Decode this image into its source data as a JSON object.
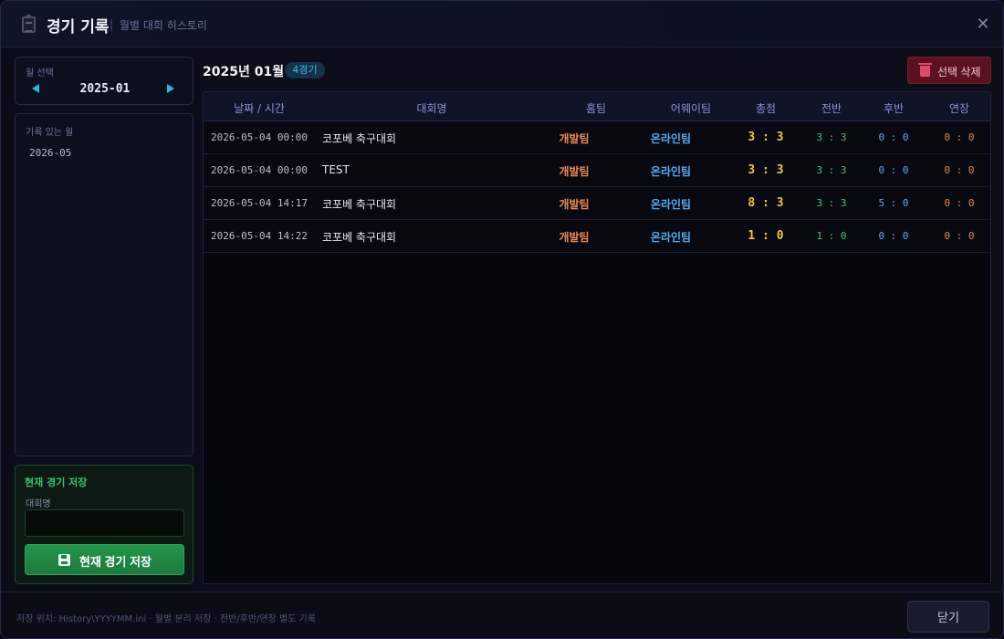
{
  "window": {
    "title": "경기 기록",
    "separator": "|",
    "subtitle": "월별 대회 히스토리",
    "close_icon": "✕"
  },
  "sidebar": {
    "month_label": "월 선택",
    "month_value": "2025-01",
    "history_label": "기록 있는 월",
    "history_items": [
      "2026-05"
    ]
  },
  "save": {
    "title": "현재 경기 저장",
    "field_label": "대회명",
    "input_value": "",
    "input_placeholder": "",
    "button_label": "현재 경기 저장"
  },
  "content": {
    "title": "2025년 01월",
    "count_badge": "4경기",
    "delete_label": "선택 삭제"
  },
  "table": {
    "headers": [
      "날짜 / 시간",
      "대회명",
      "홈팀",
      "어웨이팀",
      "총점",
      "전반",
      "후반",
      "연장"
    ],
    "rows": [
      {
        "date": "2026-05-04 00:00",
        "name": "코포베 축구대회",
        "home": "개발팀",
        "away": "온라인팀",
        "total": "3 : 3",
        "first": "3 : 3",
        "second": "0 : 0",
        "extra": "0 : 0"
      },
      {
        "date": "2026-05-04 00:00",
        "name": "TEST",
        "home": "개발팀",
        "away": "온라인팀",
        "total": "3 : 3",
        "first": "3 : 3",
        "second": "0 : 0",
        "extra": "0 : 0"
      },
      {
        "date": "2026-05-04 14:17",
        "name": "코포베 축구대회",
        "home": "개발팀",
        "away": "온라인팀",
        "total": "8 : 3",
        "first": "3 : 3",
        "second": "5 : 0",
        "extra": "0 : 0"
      },
      {
        "date": "2026-05-04 14:22",
        "name": "코포베 축구대회",
        "home": "개발팀",
        "away": "온라인팀",
        "total": "1 : 0",
        "first": "1 : 0",
        "second": "0 : 0",
        "extra": "0 : 0"
      }
    ]
  },
  "footer": {
    "note": "저장 위치: History\\YYYYMM.ini · 월별 분리 저장 · 전반/후반/연장 별도 기록",
    "close_label": "닫기"
  },
  "colors": {
    "accent": "#29b7e6",
    "home_team": "#f08a55",
    "away_team": "#55a9f0",
    "total_score": "#f2c530",
    "save_green": "#23964a",
    "delete_red": "#5a1220"
  }
}
